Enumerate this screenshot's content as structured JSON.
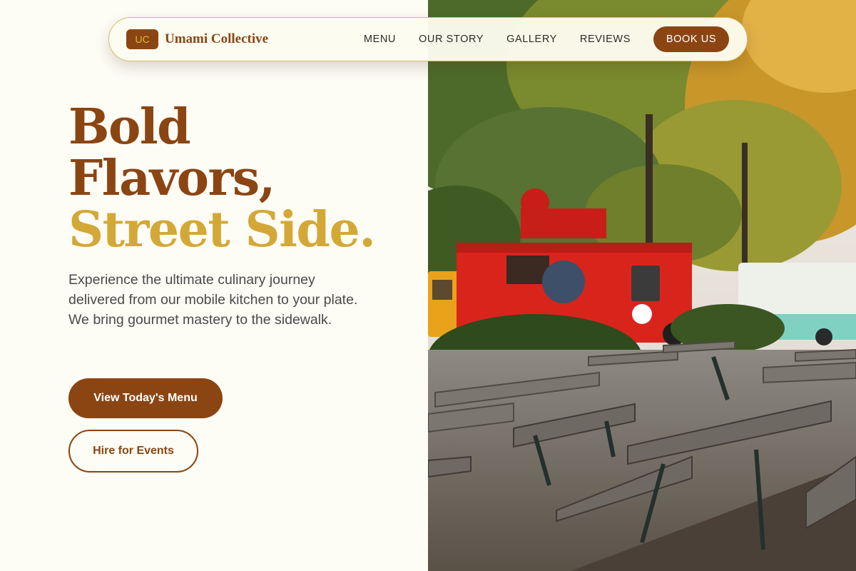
{
  "brand": {
    "badge": "UC",
    "name": "Umami Collective"
  },
  "nav": {
    "links": [
      "MENU",
      "OUR STORY",
      "GALLERY",
      "REVIEWS"
    ],
    "cta": "BOOK US"
  },
  "hero": {
    "headline_line1": "Bold",
    "headline_line2": "Flavors,",
    "headline_line3": "Street Side.",
    "description": "Experience the ultimate culinary journey delivered from our mobile kitchen to your plate. We bring gourmet mastery to the sidewalk.",
    "primary_button": "View Today's Menu",
    "secondary_button": "Hire for Events"
  },
  "colors": {
    "brand_brown": "#8b4513",
    "accent_gold": "#d4a836",
    "background": "#fdfcf5"
  }
}
